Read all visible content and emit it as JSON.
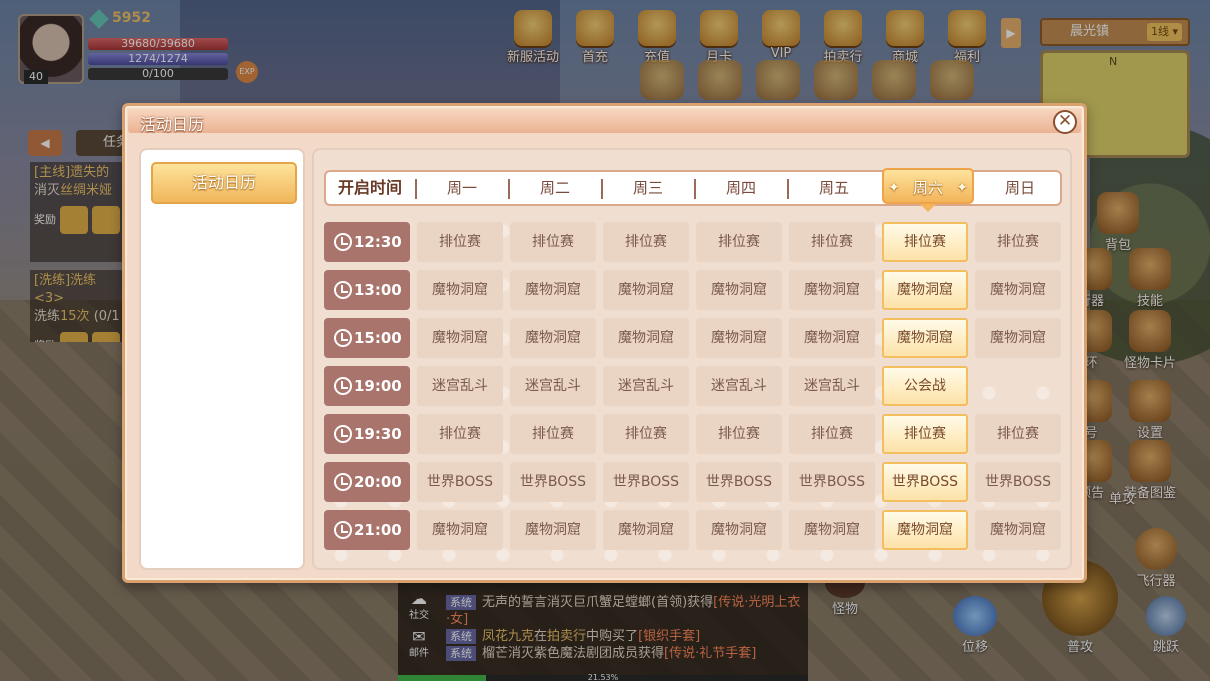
{
  "player": {
    "power": "5952",
    "level": "40",
    "hp": "39680/39680",
    "mp": "1274/1274",
    "xp": "0/100",
    "exp_label": "EXP"
  },
  "top_menu": [
    "新服活动",
    "首充",
    "充值",
    "月卡",
    "VIP",
    "拍卖行",
    "商城",
    "福利"
  ],
  "map": {
    "location": "晨光镇",
    "channel": "1线",
    "north": "N"
  },
  "side_buttons": {
    "bag": "背包",
    "weapon": "行器",
    "skill": "技能",
    "ring": "环",
    "monster_card": "怪物卡片",
    "tag": "号",
    "settings": "设置",
    "preview": "预告",
    "gear_book": "装备图鉴",
    "solo": "单攻",
    "fly": "飞行器"
  },
  "quests": [
    {
      "title": "[主线]遗失的",
      "desc_prefix": "消灭",
      "desc_target": "丝绸米娅",
      "reward_label": "奖励"
    },
    {
      "title": "[洗练]洗练<3>",
      "desc_prefix": "洗练",
      "desc_target": "15次",
      "progress": "(0/1",
      "reward_label": "奖励"
    }
  ],
  "quest_tab": "任务",
  "modal": {
    "title": "活动日历",
    "category": "活动日历",
    "close": "✕",
    "header": {
      "first": "开启时间",
      "days": [
        "周一",
        "周二",
        "周三",
        "周四",
        "周五",
        "周六",
        "周日"
      ],
      "selected_index": 5
    },
    "schedule": [
      {
        "time": "12:30",
        "events": [
          "排位赛",
          "排位赛",
          "排位赛",
          "排位赛",
          "排位赛",
          "排位赛",
          "排位赛"
        ]
      },
      {
        "time": "13:00",
        "events": [
          "魔物洞窟",
          "魔物洞窟",
          "魔物洞窟",
          "魔物洞窟",
          "魔物洞窟",
          "魔物洞窟",
          "魔物洞窟"
        ]
      },
      {
        "time": "15:00",
        "events": [
          "魔物洞窟",
          "魔物洞窟",
          "魔物洞窟",
          "魔物洞窟",
          "魔物洞窟",
          "魔物洞窟",
          "魔物洞窟"
        ]
      },
      {
        "time": "19:00",
        "events": [
          "迷宫乱斗",
          "迷宫乱斗",
          "迷宫乱斗",
          "迷宫乱斗",
          "迷宫乱斗",
          "公会战",
          ""
        ]
      },
      {
        "time": "19:30",
        "events": [
          "排位赛",
          "排位赛",
          "排位赛",
          "排位赛",
          "排位赛",
          "排位赛",
          "排位赛"
        ]
      },
      {
        "time": "20:00",
        "events": [
          "世界BOSS",
          "世界BOSS",
          "世界BOSS",
          "世界BOSS",
          "世界BOSS",
          "世界BOSS",
          "世界BOSS"
        ]
      },
      {
        "time": "21:00",
        "events": [
          "魔物洞窟",
          "魔物洞窟",
          "魔物洞窟",
          "魔物洞窟",
          "魔物洞窟",
          "魔物洞窟",
          "魔物洞窟"
        ]
      }
    ]
  },
  "chat": {
    "social": "社交",
    "mail": "邮件",
    "lines": [
      {
        "tag": "系统",
        "parts": [
          [
            "",
            "无声的誓言消灭巨爪蟹足螳螂(首领)获得"
          ],
          [
            "rd",
            "[传说·光明上衣·女]"
          ]
        ]
      },
      {
        "tag": "系统",
        "parts": [
          [
            "em",
            "凤花九克"
          ],
          [
            "",
            "在"
          ],
          [
            "em",
            "拍卖行"
          ],
          [
            "",
            "中购买了"
          ],
          [
            "rd",
            "[银织手套]"
          ]
        ]
      },
      {
        "tag": "系统",
        "parts": [
          [
            "",
            "榴芒消灭紫色魔法剧团成员获得"
          ],
          [
            "rd",
            "[传说·礼节手套]"
          ]
        ]
      }
    ],
    "progress_text": "21.53%",
    "progress": 0.2153
  },
  "combat": {
    "monster": "怪物",
    "dodge": "位移",
    "attack": "普攻",
    "jump": "跳跃"
  }
}
